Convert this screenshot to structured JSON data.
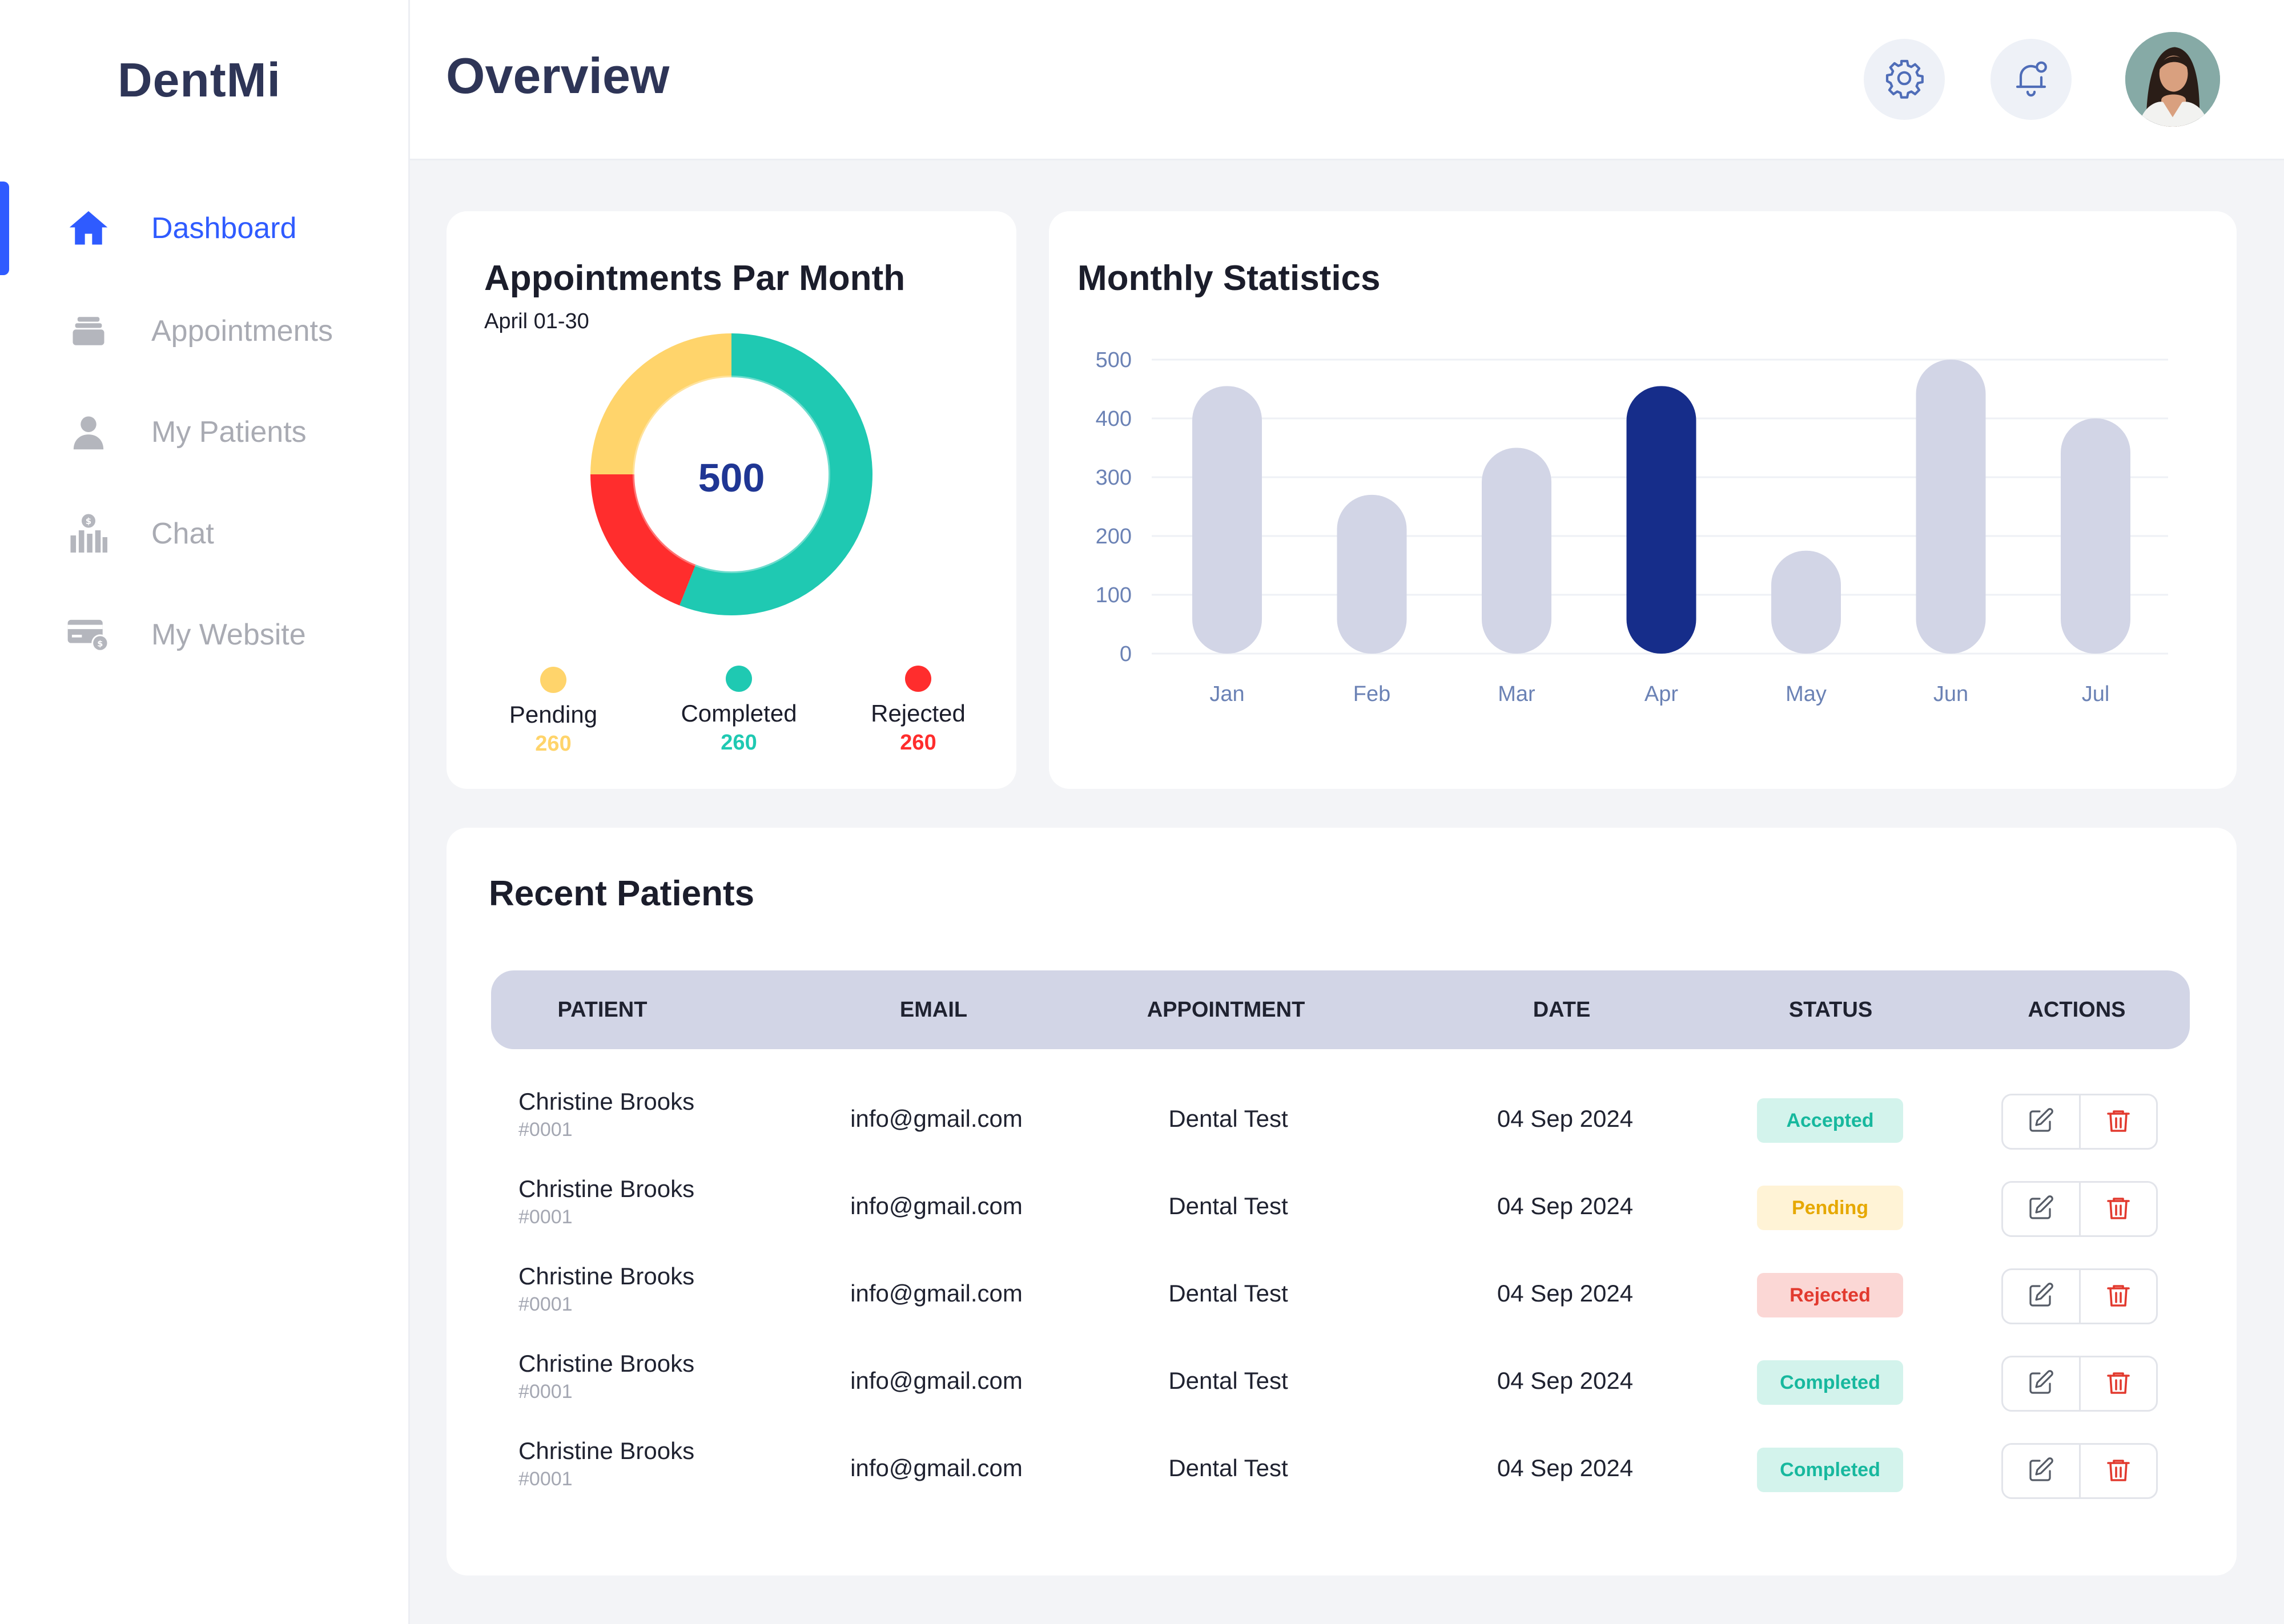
{
  "app": {
    "logo": "DentMi"
  },
  "header": {
    "title": "Overview"
  },
  "sidebar": {
    "items": [
      {
        "label": "Dashboard",
        "icon": "home-icon",
        "active": true
      },
      {
        "label": "Appointments",
        "icon": "stack-icon"
      },
      {
        "label": "My Patients",
        "icon": "user-icon"
      },
      {
        "label": "Chat",
        "icon": "chart-dollar-icon"
      },
      {
        "label": "My Website",
        "icon": "card-icon"
      }
    ]
  },
  "appointments_card": {
    "title": "Appointments Par Month",
    "subtitle": "April 01-30",
    "total": "500",
    "legend": [
      {
        "name": "Pending",
        "value": "260",
        "color": "#ffd46b"
      },
      {
        "name": "Completed",
        "value": "260",
        "color": "#1fc9b2"
      },
      {
        "name": "Rejected",
        "value": "260",
        "color": "#ff2d2d"
      }
    ]
  },
  "stats_card": {
    "title": "Monthly Statistics"
  },
  "chart_data": [
    {
      "type": "pie",
      "title": "Appointments Par Month",
      "subtitle": "April 01-30",
      "center_label": "500",
      "slices": [
        {
          "name": "Completed",
          "value": 0.56,
          "color": "#1fc9b2"
        },
        {
          "name": "Rejected",
          "value": 0.19,
          "color": "#ff2d2d"
        },
        {
          "name": "Pending",
          "value": 0.25,
          "color": "#ffd46b"
        }
      ]
    },
    {
      "type": "bar",
      "title": "Monthly Statistics",
      "categories": [
        "Jan",
        "Feb",
        "Mar",
        "Apr",
        "May",
        "Jun",
        "Jul"
      ],
      "values": [
        455,
        270,
        350,
        455,
        175,
        500,
        400
      ],
      "highlight": "Apr",
      "ylim": [
        0,
        500
      ],
      "yticks": [
        0,
        100,
        200,
        300,
        400,
        500
      ],
      "grid": true,
      "colors": {
        "bar": "#d2d5e6",
        "highlight": "#162d8a",
        "tick": "#6b82b5"
      }
    }
  ],
  "patients": {
    "title": "Recent Patients",
    "columns": [
      "PATIENT",
      "EMAIL",
      "APPOINTMENT",
      "DATE",
      "STATUS",
      "ACTIONS"
    ],
    "rows": [
      {
        "name": "Christine Brooks",
        "id": "#0001",
        "email": "info@gmail.com",
        "appointment": "Dental Test",
        "date": "04 Sep 2024",
        "status": "Accepted"
      },
      {
        "name": "Christine Brooks",
        "id": "#0001",
        "email": "info@gmail.com",
        "appointment": "Dental Test",
        "date": "04 Sep 2024",
        "status": "Pending"
      },
      {
        "name": "Christine Brooks",
        "id": "#0001",
        "email": "info@gmail.com",
        "appointment": "Dental Test",
        "date": "04 Sep 2024",
        "status": "Rejected"
      },
      {
        "name": "Christine Brooks",
        "id": "#0001",
        "email": "info@gmail.com",
        "appointment": "Dental Test",
        "date": "04 Sep 2024",
        "status": "Completed"
      },
      {
        "name": "Christine Brooks",
        "id": "#0001",
        "email": "info@gmail.com",
        "appointment": "Dental Test",
        "date": "04 Sep 2024",
        "status": "Completed"
      }
    ],
    "status_colors": {
      "Accepted": {
        "bg": "#d3f3ec",
        "fg": "#17b89e"
      },
      "Pending": {
        "bg": "#fff3d6",
        "fg": "#e6a800"
      },
      "Rejected": {
        "bg": "#fbd7d5",
        "fg": "#e23a2f"
      },
      "Completed": {
        "bg": "#d3f3ec",
        "fg": "#17b89e"
      }
    }
  }
}
